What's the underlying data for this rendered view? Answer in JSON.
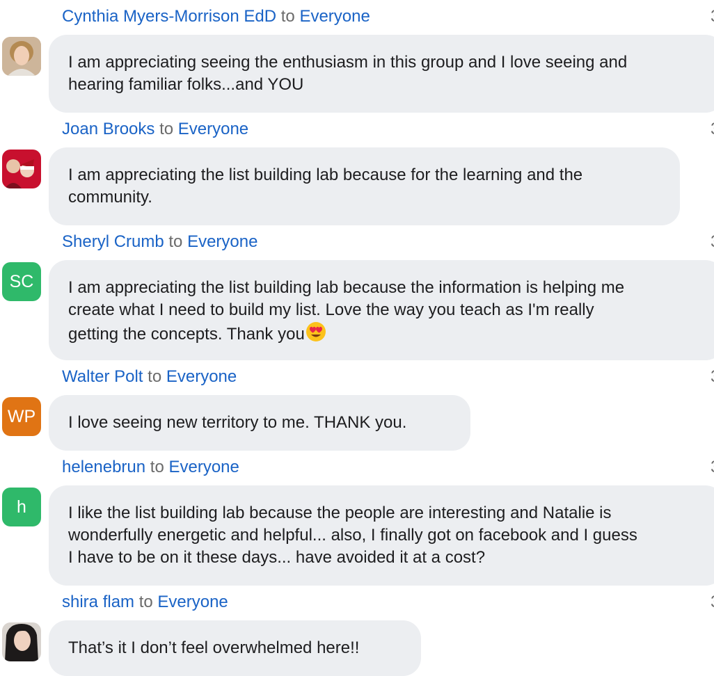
{
  "recipient_label": "to",
  "messages": [
    {
      "sender": "Cynthia Myers-Morrison EdD",
      "recipient": "Everyone",
      "time": "3",
      "avatar": {
        "type": "photo"
      },
      "lines": [
        "I am appreciating seeing the enthusiasm in this group and I love seeing and",
        "hearing familiar folks...and YOU"
      ]
    },
    {
      "sender": "Joan Brooks",
      "recipient": "Everyone",
      "time": "3",
      "avatar": {
        "type": "photo"
      },
      "lines": [
        "I am appreciating the list building lab because for the learning and the",
        "community."
      ]
    },
    {
      "sender": "Sheryl Crumb",
      "recipient": "Everyone",
      "time": "3",
      "avatar": {
        "type": "initials",
        "initials": "SC",
        "color": "#2fb96a"
      },
      "lines": [
        "I am appreciating the list building lab because the information is helping me",
        "create what I need to build my list. Love the way you teach as I'm really",
        "getting the concepts. Thank you"
      ],
      "emoji": "heart-eyes-emoji"
    },
    {
      "sender": "Walter Polt",
      "recipient": "Everyone",
      "time": "3",
      "avatar": {
        "type": "initials",
        "initials": "WP",
        "color": "#e07414"
      },
      "lines": [
        "I love seeing new territory to me. THANK you."
      ]
    },
    {
      "sender": "helenebrun",
      "recipient": "Everyone",
      "time": "3",
      "avatar": {
        "type": "initials",
        "initials": "h",
        "color": "#2fb96a"
      },
      "lines": [
        "I like the list building lab because the people are interesting and Natalie is",
        "wonderfully energetic and helpful... also, I finally got on facebook and I guess",
        "I have to be on it these days... have avoided it at a cost?"
      ]
    },
    {
      "sender": "shira flam",
      "recipient": "Everyone",
      "time": "3",
      "avatar": {
        "type": "photo"
      },
      "lines": [
        "That’s it I don’t feel overwhelmed here!!"
      ]
    }
  ]
}
